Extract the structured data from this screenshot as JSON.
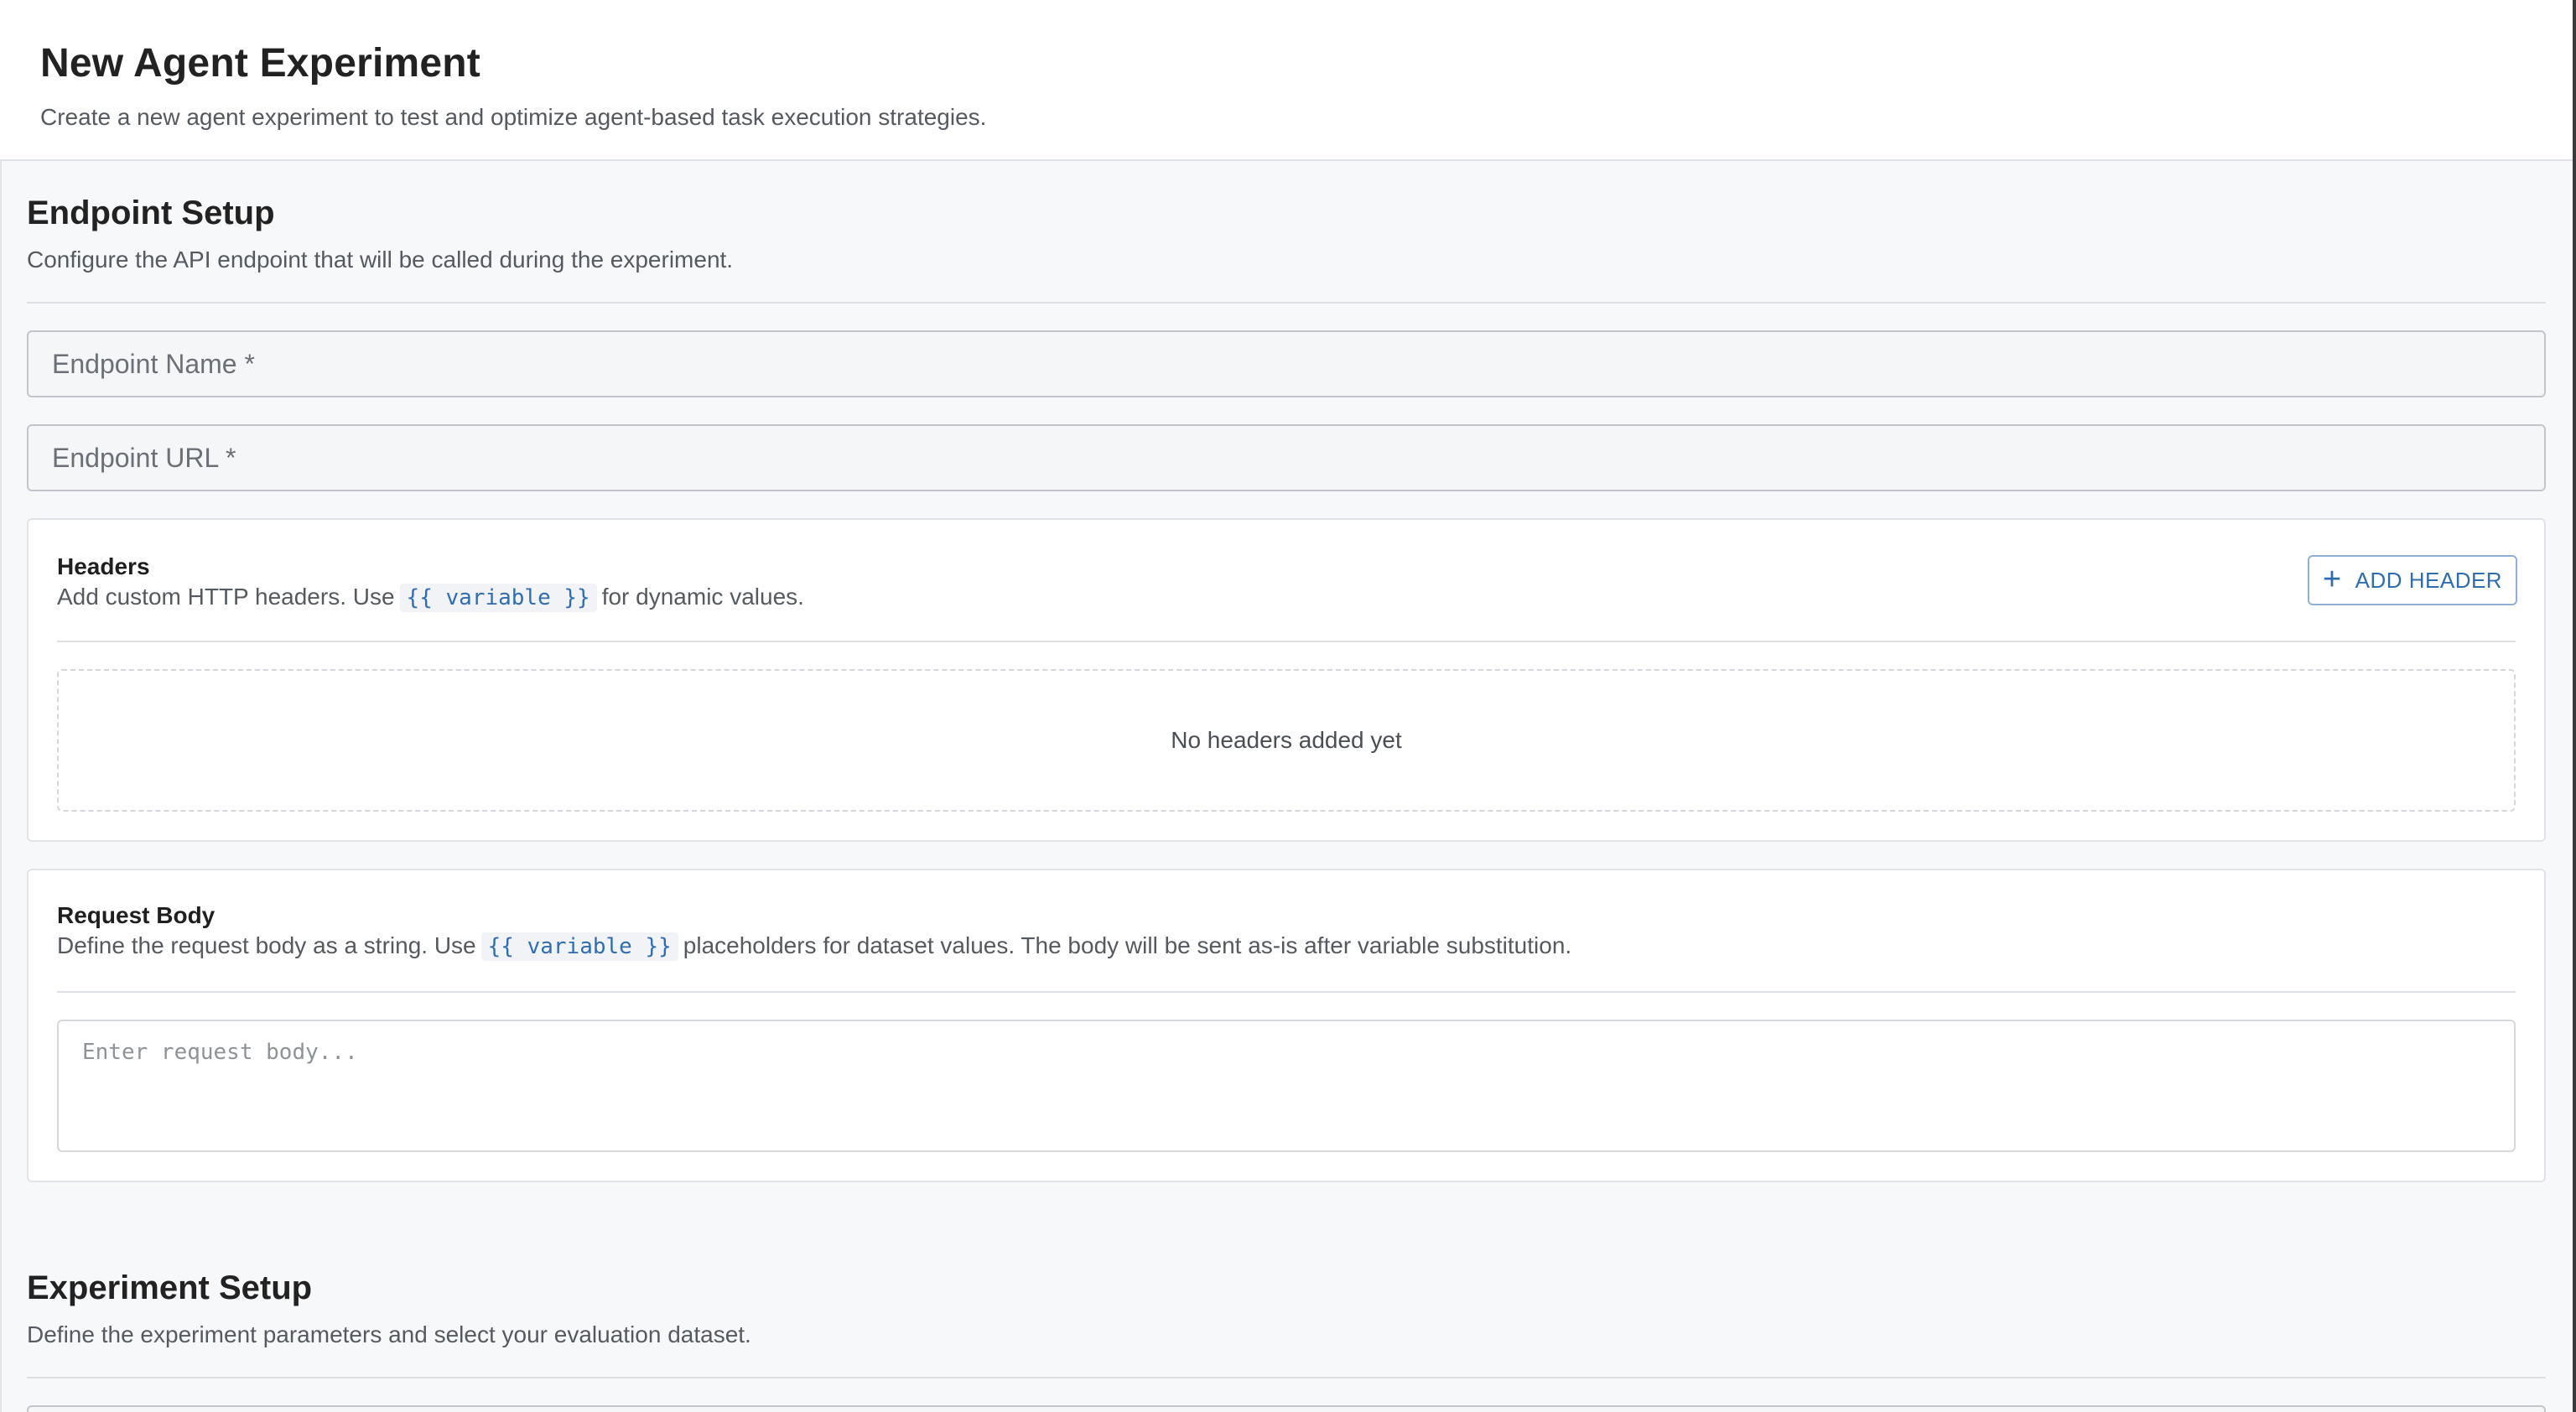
{
  "page": {
    "title": "New Agent Experiment",
    "subtitle": "Create a new agent experiment to test and optimize agent-based task execution strategies."
  },
  "endpoint_setup": {
    "title": "Endpoint Setup",
    "description": "Configure the API endpoint that will be called during the experiment.",
    "endpoint_name": {
      "value": "",
      "placeholder": "Endpoint Name *"
    },
    "endpoint_url": {
      "value": "",
      "placeholder": "Endpoint URL *"
    },
    "headers": {
      "title": "Headers",
      "desc_before": "Add custom HTTP headers. Use",
      "variable_token": "{{ variable }}",
      "desc_after": "for dynamic values.",
      "add_button_label": "ADD HEADER",
      "add_button_icon": "plus-icon",
      "empty_text": "No headers added yet"
    },
    "request_body": {
      "title": "Request Body",
      "desc_before": "Define the request body as a string. Use",
      "variable_token": "{{ variable }}",
      "desc_after": "placeholders for dataset values. The body will be sent as-is after variable substitution.",
      "value": "",
      "placeholder": "Enter request body..."
    }
  },
  "experiment_setup": {
    "title": "Experiment Setup",
    "description": "Define the experiment parameters and select your evaluation dataset."
  },
  "colors": {
    "accent": "#2f6db3",
    "background": "#f7f8fa",
    "card": "#ffffff",
    "border": "#dcdfe3"
  }
}
